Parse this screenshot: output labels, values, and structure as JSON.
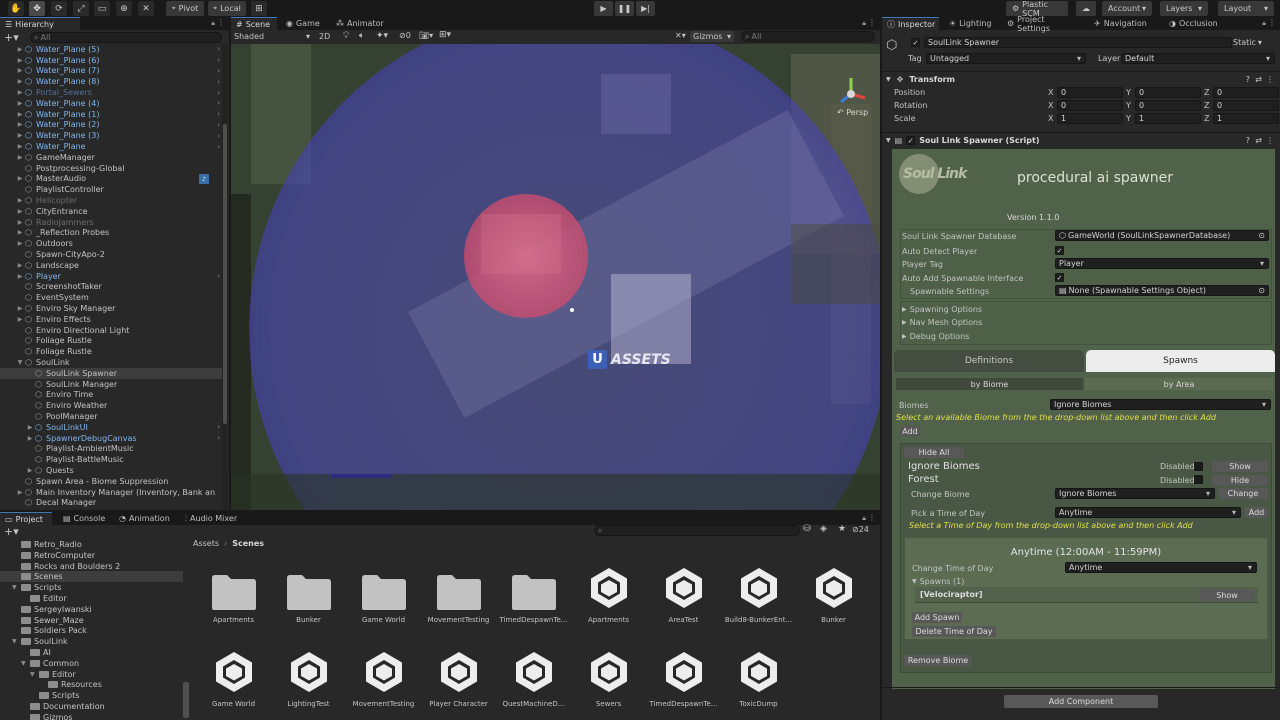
{
  "toolbar": {
    "pivot": "Pivot",
    "local": "Local",
    "plastic_scm": "Plastic SCM",
    "account": "Account",
    "layers": "Layers",
    "layout": "Layout"
  },
  "hierarchy": {
    "tab": "Hierarchy",
    "search_placeholder": "All",
    "items": [
      {
        "label": "Water_Plane (5)",
        "indent": 1,
        "prefab": true,
        "arrow": true,
        "right": true
      },
      {
        "label": "Water_Plane (6)",
        "indent": 1,
        "prefab": true,
        "arrow": true,
        "right": true
      },
      {
        "label": "Water_Plane (7)",
        "indent": 1,
        "prefab": true,
        "arrow": true,
        "right": true
      },
      {
        "label": "Water_Plane (8)",
        "indent": 1,
        "prefab": true,
        "arrow": true,
        "right": true
      },
      {
        "label": "Portal_Sewers",
        "indent": 1,
        "prefab": true,
        "arrow": true,
        "right": true,
        "disabled": true
      },
      {
        "label": "Water_Plane (4)",
        "indent": 1,
        "prefab": true,
        "arrow": true,
        "right": true
      },
      {
        "label": "Water_Plane (1)",
        "indent": 1,
        "prefab": true,
        "arrow": true,
        "right": true
      },
      {
        "label": "Water_Plane (2)",
        "indent": 1,
        "prefab": true,
        "arrow": true,
        "right": true
      },
      {
        "label": "Water_Plane (3)",
        "indent": 1,
        "prefab": true,
        "arrow": true,
        "right": true
      },
      {
        "label": "Water_Plane",
        "indent": 1,
        "prefab": true,
        "arrow": true,
        "right": true
      },
      {
        "label": "GameManager",
        "indent": 1,
        "arrow": true
      },
      {
        "label": "Postprocessing-Global",
        "indent": 1
      },
      {
        "label": "MasterAudio",
        "indent": 1,
        "arrow": true
      },
      {
        "label": "PlaylistController",
        "indent": 1
      },
      {
        "label": "Helicopter",
        "indent": 1,
        "arrow": true,
        "disabled": true
      },
      {
        "label": "CityEntrance",
        "indent": 1,
        "arrow": true
      },
      {
        "label": "RadioJammers",
        "indent": 1,
        "arrow": true,
        "disabled": true
      },
      {
        "label": "_Reflection Probes",
        "indent": 1,
        "arrow": true
      },
      {
        "label": "Outdoors",
        "indent": 1,
        "arrow": true
      },
      {
        "label": "Spawn-CityApo-2",
        "indent": 1
      },
      {
        "label": "Landscape",
        "indent": 1,
        "arrow": true
      },
      {
        "label": "Player",
        "indent": 1,
        "prefab": true,
        "arrow": true,
        "right": true
      },
      {
        "label": "ScreenshotTaker",
        "indent": 1
      },
      {
        "label": "EventSystem",
        "indent": 1
      },
      {
        "label": "Enviro Sky Manager",
        "indent": 1,
        "arrow": true
      },
      {
        "label": "Enviro Effects",
        "indent": 1,
        "arrow": true
      },
      {
        "label": "Enviro Directional Light",
        "indent": 1
      },
      {
        "label": "Foliage Rustle",
        "indent": 1
      },
      {
        "label": "Foliage Rustle",
        "indent": 1
      },
      {
        "label": "SoulLink",
        "indent": 1,
        "arrow": true,
        "open": true
      },
      {
        "label": "SoulLink Spawner",
        "indent": 2,
        "selected": true
      },
      {
        "label": "SoulLink Manager",
        "indent": 2
      },
      {
        "label": "Enviro Time",
        "indent": 2
      },
      {
        "label": "Enviro Weather",
        "indent": 2
      },
      {
        "label": "PoolManager",
        "indent": 2
      },
      {
        "label": "SoulLinkUI",
        "indent": 2,
        "prefab": true,
        "arrow": true,
        "right": true
      },
      {
        "label": "SpawnerDebugCanvas",
        "indent": 2,
        "prefab": true,
        "arrow": true,
        "right": true
      },
      {
        "label": "Playlist-AmbientMusic",
        "indent": 2
      },
      {
        "label": "Playlist-BattleMusic",
        "indent": 2
      },
      {
        "label": "Quests",
        "indent": 2,
        "arrow": true
      },
      {
        "label": "Spawn Area - Biome Suppression",
        "indent": 1
      },
      {
        "label": "Main Inventory Manager (Inventory, Bank an",
        "indent": 1,
        "arrow": true
      },
      {
        "label": "Decal Manager",
        "indent": 1
      }
    ]
  },
  "scene": {
    "tabs": [
      "Scene",
      "Game",
      "Animator"
    ],
    "shading": "Shaded",
    "mode_2d": "2D",
    "fx_count": "0",
    "gizmos": "Gizmos",
    "search_placeholder": "All",
    "persp": "Persp",
    "watermark": "ASSETS",
    "watermark_letter": "U"
  },
  "project": {
    "tabs": [
      "Project",
      "Console",
      "Animation",
      "Audio Mixer"
    ],
    "breadcrumb": [
      "Assets",
      "Scenes"
    ],
    "count": "24",
    "folders": [
      {
        "label": "Retro_Radio",
        "indent": 1
      },
      {
        "label": "RetroComputer",
        "indent": 1
      },
      {
        "label": "Rocks and Boulders 2",
        "indent": 1
      },
      {
        "label": "Scenes",
        "indent": 1,
        "selected": true
      },
      {
        "label": "Scripts",
        "indent": 1,
        "open": true
      },
      {
        "label": "Editor",
        "indent": 2
      },
      {
        "label": "SergeyIwanski",
        "indent": 1
      },
      {
        "label": "Sewer_Maze",
        "indent": 1
      },
      {
        "label": "Soldiers Pack",
        "indent": 1
      },
      {
        "label": "SoulLink",
        "indent": 1,
        "open": true
      },
      {
        "label": "AI",
        "indent": 2
      },
      {
        "label": "Common",
        "indent": 2,
        "open": true
      },
      {
        "label": "Editor",
        "indent": 3,
        "open": true
      },
      {
        "label": "Resources",
        "indent": 4
      },
      {
        "label": "Scripts",
        "indent": 3
      },
      {
        "label": "Documentation",
        "indent": 2
      },
      {
        "label": "Gizmos",
        "indent": 2
      }
    ],
    "assets_row1": [
      {
        "label": "Apartments",
        "type": "folder"
      },
      {
        "label": "Bunker",
        "type": "folder"
      },
      {
        "label": "Game World",
        "type": "folder"
      },
      {
        "label": "MovementTesting",
        "type": "folder"
      },
      {
        "label": "TimedDespawnTe...",
        "type": "folder"
      },
      {
        "label": "Apartments",
        "type": "scene"
      },
      {
        "label": "AreaTest",
        "type": "scene"
      },
      {
        "label": "Build8-BunkerEnt...",
        "type": "scene"
      },
      {
        "label": "Bunker",
        "type": "scene"
      }
    ],
    "assets_row2": [
      {
        "label": "Game World",
        "type": "scene"
      },
      {
        "label": "LightingTest",
        "type": "scene"
      },
      {
        "label": "MovementTesting",
        "type": "scene"
      },
      {
        "label": "Player Character",
        "type": "scene"
      },
      {
        "label": "QuestMachineD...",
        "type": "scene"
      },
      {
        "label": "Sewers",
        "type": "scene"
      },
      {
        "label": "TimedDespawnTe...",
        "type": "scene"
      },
      {
        "label": "ToxicDump",
        "type": "scene"
      }
    ]
  },
  "inspector": {
    "tabs": [
      "Inspector",
      "Lighting",
      "Project Settings",
      "Navigation",
      "Occlusion"
    ],
    "object_name": "SoulLink Spawner",
    "static_label": "Static",
    "tag_label": "Tag",
    "tag_value": "Untagged",
    "layer_label": "Layer",
    "layer_value": "Default",
    "transform": {
      "title": "Transform",
      "rows": [
        {
          "label": "Position",
          "x": "0",
          "y": "0",
          "z": "0"
        },
        {
          "label": "Rotation",
          "x": "0",
          "y": "0",
          "z": "0"
        },
        {
          "label": "Scale",
          "x": "1",
          "y": "1",
          "z": "1"
        }
      ]
    },
    "script": {
      "title": "Soul Link Spawner (Script)",
      "logo_text": "Soul Link",
      "tagline": "procedural ai spawner",
      "version": "Version 1.1.0",
      "db_label": "Soul Link Spawner Database",
      "db_value": "GameWorld (SoulLinkSpawnerDatabase)",
      "auto_detect_label": "Auto Detect Player",
      "player_tag_label": "Player Tag",
      "player_tag_value": "Player",
      "auto_add_label": "Auto Add Spawnable Interface",
      "spawnable_settings_label": "Spawnable Settings",
      "spawnable_settings_value": "None (Spawnable Settings Object)",
      "foldouts": [
        "Spawning Options",
        "Nav Mesh Options",
        "Debug Options"
      ],
      "main_tabs": [
        "Definitions",
        "Spawns"
      ],
      "sub_tabs": [
        "by Biome",
        "by Area"
      ],
      "biomes_label": "Biomes",
      "biomes_value": "Ignore Biomes",
      "biomes_hint": "Select an available Biome from the the drop-down list above and then click Add",
      "add": "Add",
      "hide_all": "Hide All",
      "biome1": "Ignore Biomes",
      "biome2": "Forest",
      "disabled_label": "Disabled",
      "show": "Show",
      "hide": "Hide",
      "change_biome_label": "Change Biome",
      "change_biome_value": "Ignore Biomes",
      "change": "Change",
      "pick_time_label": "Pick a Time of Day",
      "pick_time_value": "Anytime",
      "time_hint": "Select a Time of Day from the drop-down list above and then click Add",
      "time_title": "Anytime (12:00AM - 11:59PM)",
      "change_time_label": "Change Time of Day",
      "change_time_value": "Anytime",
      "spawns_label": "Spawns (1)",
      "spawn_name": "[Velociraptor]",
      "add_spawn": "Add Spawn",
      "delete_time": "Delete Time of Day",
      "remove_biome": "Remove Biome"
    },
    "add_component": "Add Component"
  }
}
